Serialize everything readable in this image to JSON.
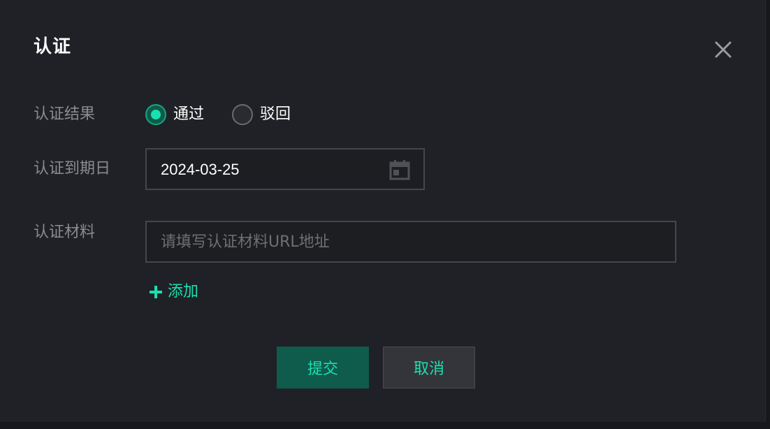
{
  "dialog": {
    "title": "认证",
    "close_icon": "close-icon"
  },
  "form": {
    "result": {
      "label": "认证结果",
      "options": [
        {
          "label": "通过",
          "checked": true
        },
        {
          "label": "驳回",
          "checked": false
        }
      ]
    },
    "expiry": {
      "label": "认证到期日",
      "value": "2024-03-25",
      "icon": "calendar-icon"
    },
    "material": {
      "label": "认证材料",
      "placeholder": "请填写认证材料URL地址",
      "value": "",
      "add_label": "添加",
      "add_icon": "plus-icon"
    }
  },
  "actions": {
    "submit_label": "提交",
    "cancel_label": "取消"
  },
  "colors": {
    "accent": "#19e0b0",
    "dialog_bg": "#202126",
    "primary_button_bg": "#0f5b4c",
    "secondary_button_bg": "#34353a"
  }
}
